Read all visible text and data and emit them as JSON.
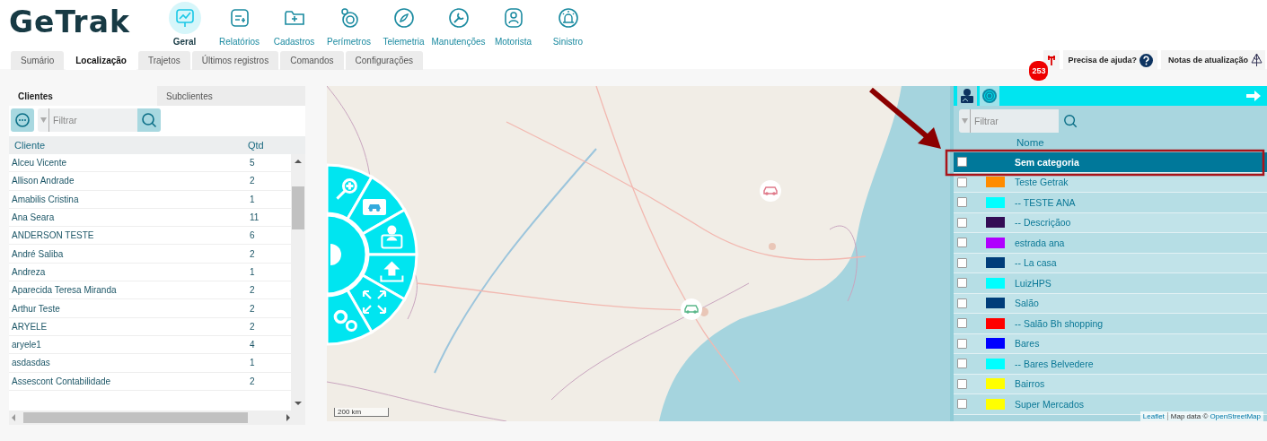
{
  "logo": "GeTrak",
  "nav": [
    {
      "label": "Geral",
      "selected": true
    },
    {
      "label": "Relatórios",
      "selected": false
    },
    {
      "label": "Cadastros",
      "selected": false
    },
    {
      "label": "Perímetros",
      "selected": false
    },
    {
      "label": "Telemetria",
      "selected": false
    },
    {
      "label": "Manutenções",
      "selected": false
    },
    {
      "label": "Motorista",
      "selected": false
    },
    {
      "label": "Sinistro",
      "selected": false
    }
  ],
  "tabs": [
    {
      "label": "Sumário",
      "selected": false
    },
    {
      "label": "Localização",
      "selected": true
    },
    {
      "label": "Trajetos",
      "selected": false
    },
    {
      "label": "Últimos registros",
      "selected": false
    },
    {
      "label": "Comandos",
      "selected": false
    },
    {
      "label": "Configurações",
      "selected": false
    }
  ],
  "alerts": {
    "count": "253"
  },
  "help": {
    "label": "Precisa de ajuda?"
  },
  "updates": {
    "label": "Notas de atualização"
  },
  "clients": {
    "tabs": [
      {
        "label": "Clientes",
        "selected": true
      },
      {
        "label": "Subclientes",
        "selected": false
      }
    ],
    "filter": {
      "placeholder": "Filtrar"
    },
    "columns": [
      "Cliente",
      "Qtd"
    ],
    "rows": [
      {
        "name": "Alceu Vicente",
        "qty": "5"
      },
      {
        "name": "Allison Andrade",
        "qty": "2"
      },
      {
        "name": "Amabilis Cristina",
        "qty": "1"
      },
      {
        "name": "Ana Seara",
        "qty": "11"
      },
      {
        "name": "ANDERSON TESTE",
        "qty": "6"
      },
      {
        "name": "André Saliba",
        "qty": "2"
      },
      {
        "name": "Andreza",
        "qty": "1"
      },
      {
        "name": "Aparecida Teresa Miranda",
        "qty": "2"
      },
      {
        "name": "Arthur Teste",
        "qty": "2"
      },
      {
        "name": "ARYELE",
        "qty": "2"
      },
      {
        "name": "aryele1",
        "qty": "4"
      },
      {
        "name": "asdasdas",
        "qty": "1"
      },
      {
        "name": "Assescont Contabilidade",
        "qty": "2"
      }
    ]
  },
  "map": {
    "kind": "picture",
    "scale": "200 km",
    "attribution": {
      "library": "Leaflet",
      "data_label": "Map data ©",
      "data_link": "OpenStreetMap"
    }
  },
  "categories": {
    "filter": {
      "placeholder": "Filtrar"
    },
    "column": "Nome",
    "rows": [
      {
        "name": "Sem categoria",
        "checked": false,
        "selected": true
      },
      {
        "name": "Teste Getrak",
        "color": "#ff8c00",
        "checked": false,
        "selected": false
      },
      {
        "name": "-- TESTE ANA",
        "color": "#00ffff",
        "checked": false,
        "selected": false
      },
      {
        "name": "-- Descriçãoo",
        "color": "#330c55",
        "checked": false,
        "selected": false
      },
      {
        "name": "estrada ana",
        "color": "#b000ff",
        "checked": false,
        "selected": false
      },
      {
        "name": "-- La casa",
        "color": "#003d7a",
        "checked": false,
        "selected": false
      },
      {
        "name": "LuizHPS",
        "color": "#00ffff",
        "checked": false,
        "selected": false
      },
      {
        "name": "Salão",
        "color": "#003d7a",
        "checked": false,
        "selected": false
      },
      {
        "name": "-- Salão Bh shopping",
        "color": "#ff0000",
        "checked": false,
        "selected": false
      },
      {
        "name": "Bares",
        "color": "#0000ff",
        "checked": false,
        "selected": false
      },
      {
        "name": "-- Bares Belvedere",
        "color": "#00ffff",
        "checked": false,
        "selected": false
      },
      {
        "name": "Bairros",
        "color": "#ffff00",
        "checked": false,
        "selected": false
      },
      {
        "name": "Super Mercados",
        "color": "#ffff00",
        "checked": false,
        "selected": false
      }
    ]
  }
}
